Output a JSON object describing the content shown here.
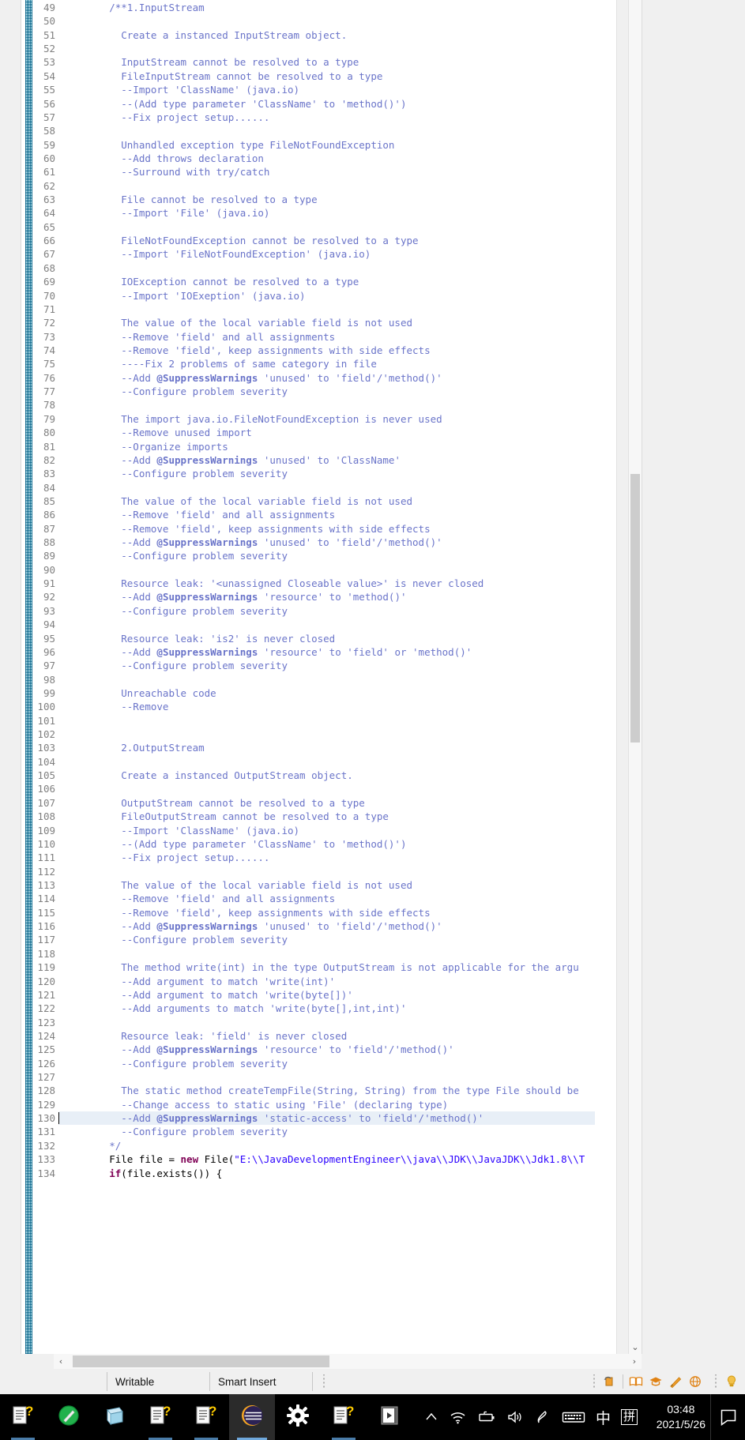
{
  "editor": {
    "first_line": 49,
    "highlighted_line": 130,
    "lines": [
      {
        "n": 49,
        "indent": 8,
        "cls": "cmt",
        "text": "/**1.InputStream"
      },
      {
        "n": 50,
        "indent": 0,
        "cls": "cmt",
        "text": ""
      },
      {
        "n": 51,
        "indent": 10,
        "cls": "cmt",
        "text": "Create a instanced InputStream object."
      },
      {
        "n": 52,
        "indent": 0,
        "cls": "cmt",
        "text": ""
      },
      {
        "n": 53,
        "indent": 10,
        "cls": "cmt",
        "text": "InputStream cannot be resolved to a type"
      },
      {
        "n": 54,
        "indent": 10,
        "cls": "cmt",
        "text": "FileInputStream cannot be resolved to a type"
      },
      {
        "n": 55,
        "indent": 10,
        "cls": "cmt",
        "text": "--Import 'ClassName' (java.io)"
      },
      {
        "n": 56,
        "indent": 10,
        "cls": "cmt",
        "text": "--(Add type parameter 'ClassName' to 'method()')"
      },
      {
        "n": 57,
        "indent": 10,
        "cls": "cmt",
        "text": "--Fix project setup......"
      },
      {
        "n": 58,
        "indent": 0,
        "cls": "cmt",
        "text": ""
      },
      {
        "n": 59,
        "indent": 10,
        "cls": "cmt",
        "text": "Unhandled exception type FileNotFoundException"
      },
      {
        "n": 60,
        "indent": 10,
        "cls": "cmt",
        "text": "--Add throws declaration"
      },
      {
        "n": 61,
        "indent": 10,
        "cls": "cmt",
        "text": "--Surround with try/catch"
      },
      {
        "n": 62,
        "indent": 0,
        "cls": "cmt",
        "text": ""
      },
      {
        "n": 63,
        "indent": 10,
        "cls": "cmt",
        "text": "File cannot be resolved to a type"
      },
      {
        "n": 64,
        "indent": 10,
        "cls": "cmt",
        "text": "--Import 'File' (java.io)"
      },
      {
        "n": 65,
        "indent": 0,
        "cls": "cmt",
        "text": ""
      },
      {
        "n": 66,
        "indent": 10,
        "cls": "cmt",
        "text": "FileNotFoundException cannot be resolved to a type"
      },
      {
        "n": 67,
        "indent": 10,
        "cls": "cmt",
        "text": "--Import 'FileNotFoundException' (java.io)"
      },
      {
        "n": 68,
        "indent": 0,
        "cls": "cmt",
        "text": ""
      },
      {
        "n": 69,
        "indent": 10,
        "cls": "cmt",
        "text": "IOException cannot be resolved to a type"
      },
      {
        "n": 70,
        "indent": 10,
        "cls": "cmt",
        "text": "--Import 'IOExeption' (java.io)"
      },
      {
        "n": 71,
        "indent": 0,
        "cls": "cmt",
        "text": ""
      },
      {
        "n": 72,
        "indent": 10,
        "cls": "cmt",
        "text": "The value of the local variable field is not used"
      },
      {
        "n": 73,
        "indent": 10,
        "cls": "cmt",
        "text": "--Remove 'field' and all assignments"
      },
      {
        "n": 74,
        "indent": 10,
        "cls": "cmt",
        "text": "--Remove 'field', keep assignments with side effects"
      },
      {
        "n": 75,
        "indent": 10,
        "cls": "cmt",
        "text": "----Fix 2 problems of same category in file"
      },
      {
        "n": 76,
        "indent": 10,
        "cls": "cmt",
        "tag": "@SuppressWarnings",
        "pre": "--Add ",
        "post": " 'unused' to 'field'/'method()'"
      },
      {
        "n": 77,
        "indent": 10,
        "cls": "cmt",
        "text": "--Configure problem severity"
      },
      {
        "n": 78,
        "indent": 0,
        "cls": "cmt",
        "text": ""
      },
      {
        "n": 79,
        "indent": 10,
        "cls": "cmt",
        "text": "The import java.io.FileNotFoundException is never used"
      },
      {
        "n": 80,
        "indent": 10,
        "cls": "cmt",
        "text": "--Remove unused import"
      },
      {
        "n": 81,
        "indent": 10,
        "cls": "cmt",
        "text": "--Organize imports"
      },
      {
        "n": 82,
        "indent": 10,
        "cls": "cmt",
        "tag": "@SuppressWarnings",
        "pre": "--Add ",
        "post": " 'unused' to 'ClassName'"
      },
      {
        "n": 83,
        "indent": 10,
        "cls": "cmt",
        "text": "--Configure problem severity"
      },
      {
        "n": 84,
        "indent": 0,
        "cls": "cmt",
        "text": ""
      },
      {
        "n": 85,
        "indent": 10,
        "cls": "cmt",
        "text": "The value of the local variable field is not used"
      },
      {
        "n": 86,
        "indent": 10,
        "cls": "cmt",
        "text": "--Remove 'field' and all assignments"
      },
      {
        "n": 87,
        "indent": 10,
        "cls": "cmt",
        "text": "--Remove 'field', keep assignments with side effects"
      },
      {
        "n": 88,
        "indent": 10,
        "cls": "cmt",
        "tag": "@SuppressWarnings",
        "pre": "--Add ",
        "post": " 'unused' to 'field'/'method()'"
      },
      {
        "n": 89,
        "indent": 10,
        "cls": "cmt",
        "text": "--Configure problem severity"
      },
      {
        "n": 90,
        "indent": 0,
        "cls": "cmt",
        "text": ""
      },
      {
        "n": 91,
        "indent": 10,
        "cls": "cmt",
        "text": "Resource leak: '<unassigned Closeable value>' is never closed"
      },
      {
        "n": 92,
        "indent": 10,
        "cls": "cmt",
        "tag": "@SuppressWarnings",
        "pre": "--Add ",
        "post": " 'resource' to 'method()'"
      },
      {
        "n": 93,
        "indent": 10,
        "cls": "cmt",
        "text": "--Configure problem severity"
      },
      {
        "n": 94,
        "indent": 0,
        "cls": "cmt",
        "text": ""
      },
      {
        "n": 95,
        "indent": 10,
        "cls": "cmt",
        "text": "Resource leak: 'is2' is never closed"
      },
      {
        "n": 96,
        "indent": 10,
        "cls": "cmt",
        "tag": "@SuppressWarnings",
        "pre": "--Add ",
        "post": " 'resource' to 'field' or 'method()'"
      },
      {
        "n": 97,
        "indent": 10,
        "cls": "cmt",
        "text": "--Configure problem severity"
      },
      {
        "n": 98,
        "indent": 0,
        "cls": "cmt",
        "text": ""
      },
      {
        "n": 99,
        "indent": 10,
        "cls": "cmt",
        "text": "Unreachable code"
      },
      {
        "n": 100,
        "indent": 10,
        "cls": "cmt",
        "text": "--Remove"
      },
      {
        "n": 101,
        "indent": 0,
        "cls": "cmt",
        "text": ""
      },
      {
        "n": 102,
        "indent": 0,
        "cls": "cmt",
        "text": ""
      },
      {
        "n": 103,
        "indent": 10,
        "cls": "cmt",
        "text": "2.OutputStream"
      },
      {
        "n": 104,
        "indent": 0,
        "cls": "cmt",
        "text": ""
      },
      {
        "n": 105,
        "indent": 10,
        "cls": "cmt",
        "text": "Create a instanced OutputStream object."
      },
      {
        "n": 106,
        "indent": 0,
        "cls": "cmt",
        "text": ""
      },
      {
        "n": 107,
        "indent": 10,
        "cls": "cmt",
        "text": "OutputStream cannot be resolved to a type"
      },
      {
        "n": 108,
        "indent": 10,
        "cls": "cmt",
        "text": "FileOutputStream cannot be resolved to a type"
      },
      {
        "n": 109,
        "indent": 10,
        "cls": "cmt",
        "text": "--Import 'ClassName' (java.io)"
      },
      {
        "n": 110,
        "indent": 10,
        "cls": "cmt",
        "text": "--(Add type parameter 'ClassName' to 'method()')"
      },
      {
        "n": 111,
        "indent": 10,
        "cls": "cmt",
        "text": "--Fix project setup......"
      },
      {
        "n": 112,
        "indent": 0,
        "cls": "cmt",
        "text": ""
      },
      {
        "n": 113,
        "indent": 10,
        "cls": "cmt",
        "text": "The value of the local variable field is not used"
      },
      {
        "n": 114,
        "indent": 10,
        "cls": "cmt",
        "text": "--Remove 'field' and all assignments"
      },
      {
        "n": 115,
        "indent": 10,
        "cls": "cmt",
        "text": "--Remove 'field', keep assignments with side effects"
      },
      {
        "n": 116,
        "indent": 10,
        "cls": "cmt",
        "tag": "@SuppressWarnings",
        "pre": "--Add ",
        "post": " 'unused' to 'field'/'method()'"
      },
      {
        "n": 117,
        "indent": 10,
        "cls": "cmt",
        "text": "--Configure problem severity"
      },
      {
        "n": 118,
        "indent": 0,
        "cls": "cmt",
        "text": ""
      },
      {
        "n": 119,
        "indent": 10,
        "cls": "cmt",
        "text": "The method write(int) in the type OutputStream is not applicable for the argu"
      },
      {
        "n": 120,
        "indent": 10,
        "cls": "cmt",
        "text": "--Add argument to match 'write(int)'"
      },
      {
        "n": 121,
        "indent": 10,
        "cls": "cmt",
        "text": "--Add argument to match 'write(byte[])'"
      },
      {
        "n": 122,
        "indent": 10,
        "cls": "cmt",
        "text": "--Add arguments to match 'write(byte[],int,int)'"
      },
      {
        "n": 123,
        "indent": 0,
        "cls": "cmt",
        "text": ""
      },
      {
        "n": 124,
        "indent": 10,
        "cls": "cmt",
        "text": "Resource leak: 'field' is never closed"
      },
      {
        "n": 125,
        "indent": 10,
        "cls": "cmt",
        "tag": "@SuppressWarnings",
        "pre": "--Add ",
        "post": " 'resource' to 'field'/'method()'"
      },
      {
        "n": 126,
        "indent": 10,
        "cls": "cmt",
        "text": "--Configure problem severity"
      },
      {
        "n": 127,
        "indent": 0,
        "cls": "cmt",
        "text": ""
      },
      {
        "n": 128,
        "indent": 10,
        "cls": "cmt",
        "text": "The static method createTempFile(String, String) from the type File should be"
      },
      {
        "n": 129,
        "indent": 10,
        "cls": "cmt",
        "text": "--Change access to static using 'File' (declaring type)"
      },
      {
        "n": 130,
        "indent": 10,
        "cls": "cmt",
        "tag": "@SuppressWarnings",
        "pre": "--Add ",
        "post": " 'static-access' to 'field'/'method()'",
        "highlight": true
      },
      {
        "n": 131,
        "indent": 10,
        "cls": "cmt",
        "text": "--Configure problem severity"
      },
      {
        "n": 132,
        "indent": 8,
        "cls": "cmt",
        "text": "*/"
      },
      {
        "n": 133,
        "indent": 8,
        "cls": "code",
        "segments": [
          {
            "t": "File file = ",
            "c": "plain"
          },
          {
            "t": "new",
            "c": "kw"
          },
          {
            "t": " File(",
            "c": "plain"
          },
          {
            "t": "\"E:\\\\JavaDevelopmentEngineer\\\\java\\\\JDK\\\\JavaJDK\\\\Jdk1.8\\\\T",
            "c": "str"
          }
        ]
      },
      {
        "n": 134,
        "indent": 8,
        "cls": "code",
        "segments": [
          {
            "t": "if",
            "c": "kw"
          },
          {
            "t": "(file.exists()) {",
            "c": "plain"
          }
        ]
      }
    ]
  },
  "hscroll": {
    "left_arrow": "‹",
    "right_arrow": "›"
  },
  "vscroll": {
    "down_arrow": "⌄"
  },
  "status_bar": {
    "writable": "Writable",
    "insert_mode": "Smart Insert",
    "icons": [
      "editor-lock-icon",
      "book-icon",
      "graduation-cap-icon",
      "pencil-wand-icon",
      "globe-icon",
      "tip-bulb-icon"
    ]
  },
  "taskbar": {
    "apps": [
      {
        "name": "task-help-doc-1",
        "icon": "document-question-icon",
        "state": "running"
      },
      {
        "name": "task-green-pencil",
        "icon": "green-circle-pencil-icon",
        "state": "idle"
      },
      {
        "name": "task-notebook",
        "icon": "notebook-icon",
        "state": "idle"
      },
      {
        "name": "task-help-doc-2",
        "icon": "document-question-icon",
        "state": "running"
      },
      {
        "name": "task-help-doc-3",
        "icon": "document-question-icon",
        "state": "running"
      },
      {
        "name": "task-eclipse",
        "icon": "eclipse-icon",
        "state": "active"
      },
      {
        "name": "task-settings",
        "icon": "gear-icon",
        "state": "idle"
      },
      {
        "name": "task-help-doc-4",
        "icon": "document-question-icon",
        "state": "running"
      },
      {
        "name": "task-media",
        "icon": "media-player-icon",
        "state": "idle"
      }
    ],
    "tray": [
      "show-hidden-icons-chevron",
      "wifi-icon",
      "battery-icon",
      "volume-icon",
      "pen-icon",
      "keyboard-icon",
      "ime-chinese-icon",
      "ime-pinyin-icon"
    ],
    "ime_chinese_label": "中",
    "ime_pinyin_label": "拼",
    "clock_time": "03:48",
    "clock_date": "2021/5/26",
    "notifications_icon": "action-center-icon"
  },
  "colors": {
    "comment": "#6a74c9",
    "keyword": "#7f0055",
    "string": "#2a00ff",
    "gutter_text": "#808080",
    "highlight_line": "#e8eff7",
    "change_bar": "#2a8fae",
    "taskbar_bg": "#000000",
    "status_bg": "#f0f0f0"
  }
}
